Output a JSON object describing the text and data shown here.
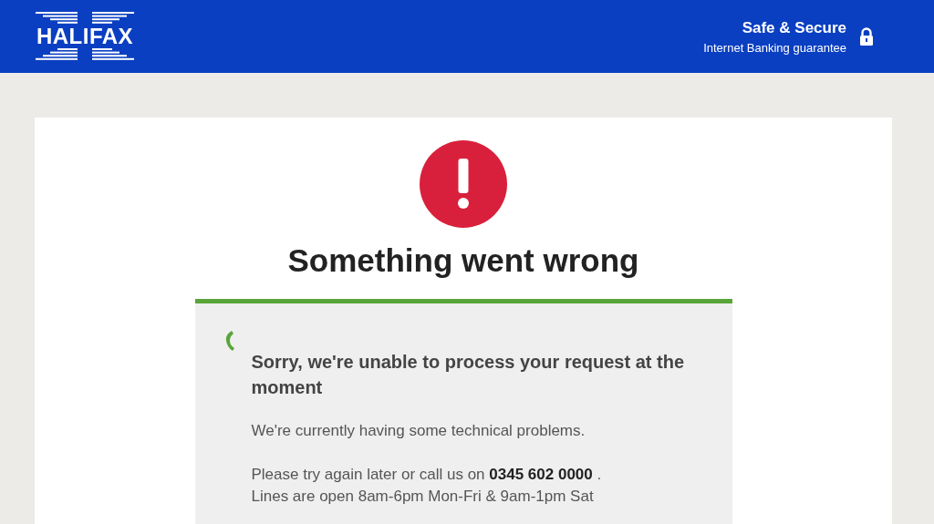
{
  "header": {
    "logo": "HALIFAX",
    "security_title": "Safe & Secure",
    "security_subtitle": "Internet Banking guarantee"
  },
  "error": {
    "title": "Something went wrong",
    "heading": "Sorry, we're unable to process your request at the moment",
    "message": "We're currently having some technical problems.",
    "contact": "Please try again later or call us on **0345 602 0000** .",
    "hours": "Lines are open 8am-6pm Mon-Fri & 9am-1pm Sat"
  }
}
